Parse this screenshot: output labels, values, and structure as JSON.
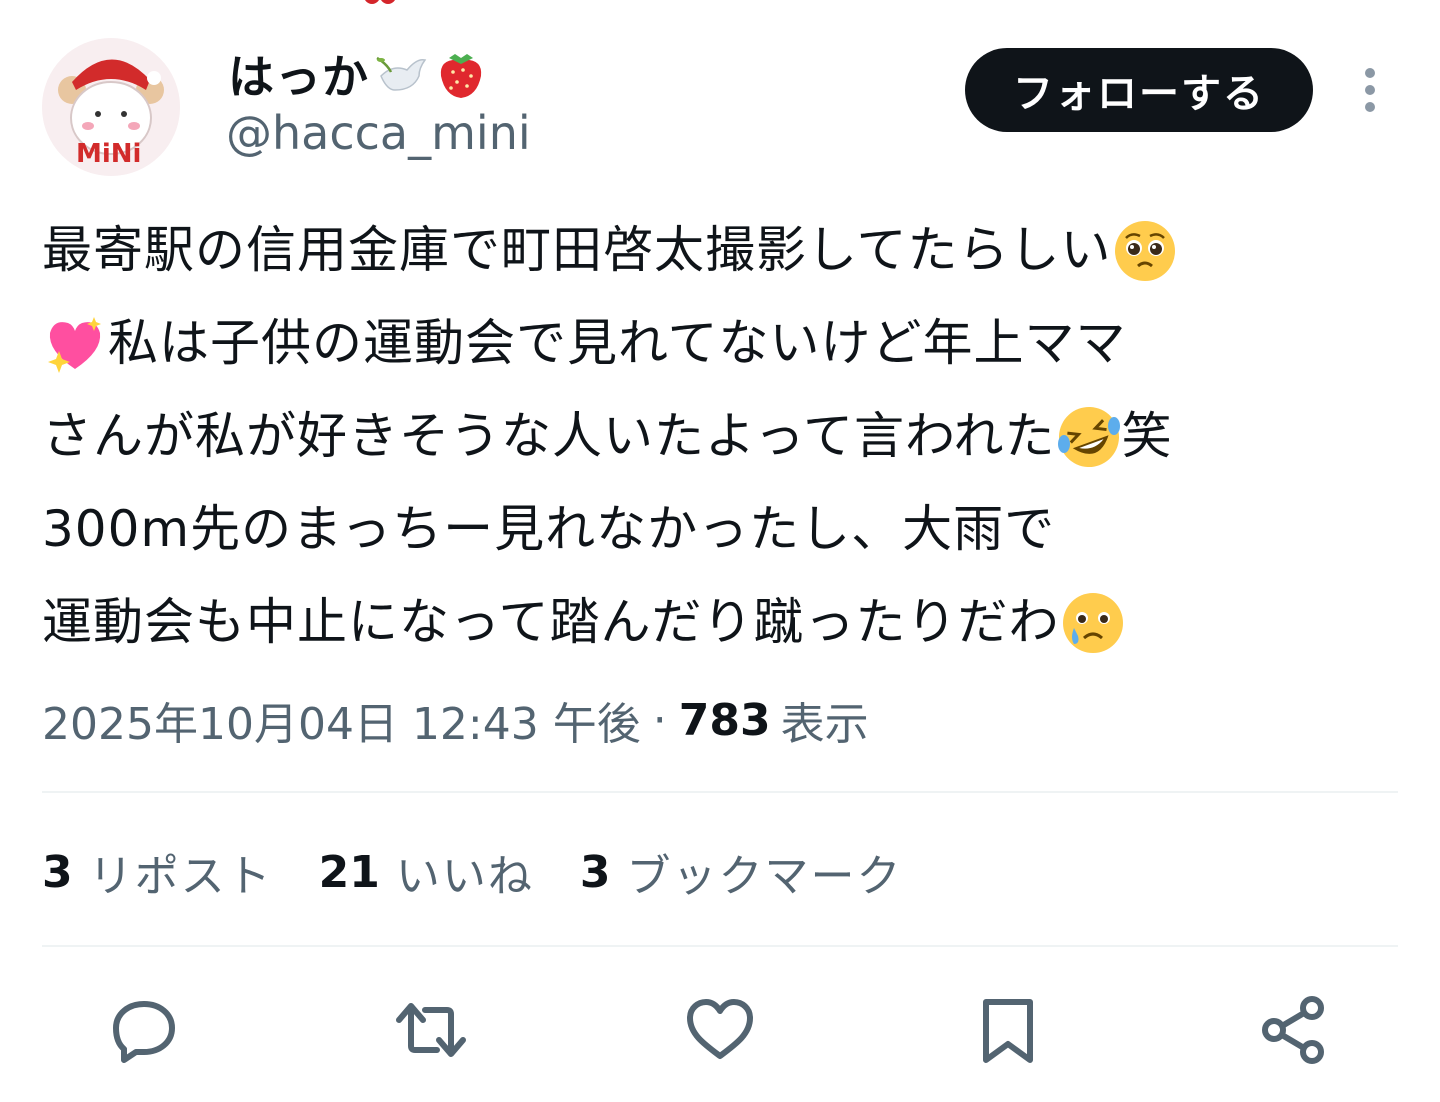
{
  "author": {
    "display_name": "はっか",
    "handle": "@hacca_mini",
    "name_emojis": [
      "dove-emoji",
      "strawberry-emoji"
    ]
  },
  "follow_button": {
    "label": "フォローする"
  },
  "tweet": {
    "lines": [
      {
        "text": "最寄駅の信用金庫で町田啓太撮影してたらしい",
        "lead_emoji": "",
        "trail_emoji": "pleading-face-emoji"
      },
      {
        "text": "私は子供の運動会で見れてないけど年上ママ",
        "lead_emoji": "sparkling-heart-emoji",
        "trail_emoji": ""
      },
      {
        "text_before": "さんが私が好きそうな人いたよって言われた",
        "mid_emoji": "rolling-laughing-emoji",
        "text_after": "笑"
      },
      {
        "text": "300m先のまっちー見れなかったし、大雨で",
        "lead_emoji": "",
        "trail_emoji": ""
      },
      {
        "text": "運動会も中止になって踏んだり蹴ったりだわ",
        "lead_emoji": "",
        "trail_emoji": "crying-face-emoji"
      }
    ]
  },
  "meta": {
    "timestamp": "2025年10月04日 12:43 午後",
    "separator": "·",
    "views_count": "783",
    "views_label": "表示"
  },
  "stats": [
    {
      "count": "3",
      "label": "リポスト"
    },
    {
      "count": "21",
      "label": "いいね"
    },
    {
      "count": "3",
      "label": "ブックマーク"
    }
  ],
  "action_bar": [
    "reply-icon",
    "retweet-icon",
    "like-icon",
    "bookmark-icon",
    "share-icon"
  ],
  "colors": {
    "text": "#0f1419",
    "secondary": "#536471",
    "divider": "#eff3f4",
    "button_bg": "#0f1419"
  }
}
